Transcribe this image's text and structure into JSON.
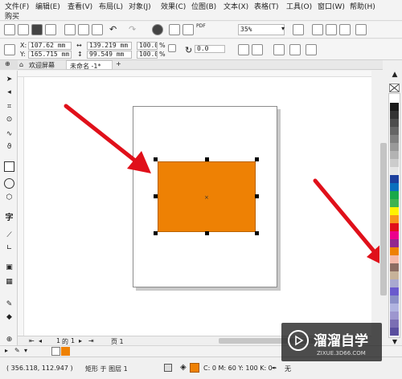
{
  "menu": [
    "文件(F)",
    "编辑(E)",
    "查看(V)",
    "布局(L)",
    "对象(J)",
    "效果(C)",
    "位图(B)",
    "文本(X)",
    "表格(T)",
    "工具(O)",
    "窗口(W)",
    "帮助(H)"
  ],
  "menu_second_row": "购买",
  "toolbar": {
    "zoom": "35%",
    "pdf_label": "PDF"
  },
  "property_bar": {
    "x_label": "X:",
    "x_value": "107.62 mm",
    "y_label": "Y:",
    "y_value": "165.715 mm",
    "width_value": "139.219 mm",
    "height_value": "99.549 mm",
    "scale_x": "100.0",
    "scale_y": "100.0",
    "percent": "%",
    "rotation": "0.0"
  },
  "tabs": {
    "welcome": "欢迎屏幕",
    "document": "未命名 -1*",
    "add": "+"
  },
  "page_nav": {
    "current": "1",
    "of": "的",
    "total": "1",
    "page_tab": "页 1"
  },
  "status": {
    "coords": "( 356.118, 112.947 )",
    "object_info": "矩形 于 图层 1",
    "fill_info": "C: 0 M: 60 Y: 100 K: 0",
    "outline_info": "无"
  },
  "colors": {
    "rect_fill": "#ee8104",
    "arrow": "#e0101a"
  },
  "palette": [
    "#ffffff",
    "#1a1a1a",
    "#333333",
    "#4d4d4d",
    "#666666",
    "#808080",
    "#999999",
    "#b3b3b3",
    "#cccccc",
    "#e6e6e6",
    "#1c3f9c",
    "#0a6fbd",
    "#18a84a",
    "#3fb34f",
    "#fff200",
    "#f7941d",
    "#e0101a",
    "#ec008c",
    "#92278f",
    "#ee8104",
    "#f4b9a9",
    "#8c6d62",
    "#c7b299",
    "#a9a9d0",
    "#6a5acd",
    "#8b8fc7",
    "#b0b3e0",
    "#9d96cf",
    "#7b6fb3",
    "#5a4f9e"
  ],
  "watermark": {
    "title": "溜溜自学",
    "url": "ZIXUE.3D66.COM"
  }
}
